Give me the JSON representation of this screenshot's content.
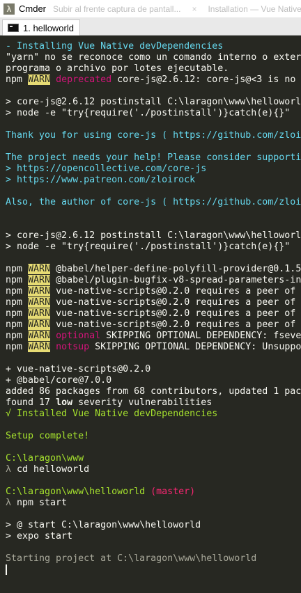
{
  "window": {
    "title": "Cmder",
    "ghost_tab_1": "Subir al frente captura de pantall...",
    "ghost_tab_1_close": "×",
    "ghost_tab_2": "Installation — Vue Native"
  },
  "tab": {
    "label": "1. helloworld"
  },
  "colors": {
    "background": "#272822",
    "warn_bg": "#e6db74",
    "accent_cyan": "#66d9ef",
    "accent_green": "#a6e22e"
  },
  "console": {
    "installing": "- Installing Vue Native devDependencies",
    "yarn_error_1": "\"yarn\" no se reconoce como un comando interno o exter",
    "yarn_error_2": "programa o archivo por lotes ejecutable.",
    "npm": "npm",
    "warn": "WARN",
    "deprecated": "deprecated",
    "deprecated_msg": " core-js@2.6.12: core-js@<3 is no",
    "postinstall_1a": "> core-js@2.6.12 postinstall C:\\laragon\\www\\helloworl",
    "postinstall_1b": "> node -e \"try{require('./postinstall')}catch(e){}\"",
    "thanks_prefix": "Thank you for using core-js ( ",
    "thanks_link": "https://github.com/zloi",
    "needs_help": "The project needs your help! Please consider supporti",
    "opencollective": "> https://opencollective.com/core-js",
    "patreon": "> https://www.patreon.com/zloirock",
    "author_prefix": "Also, the author of core-js ( ",
    "author_link": "https://github.com/zloi",
    "postinstall_2a": "> core-js@2.6.12 postinstall C:\\laragon\\www\\helloworl",
    "postinstall_2b": "> node -e \"try{require('./postinstall')}catch(e){}\"",
    "warn_1": " @babel/helper-define-polyfill-provider@0.1.5",
    "warn_2": " @babel/plugin-bugfix-v8-spread-parameters-in",
    "warn_3": " vue-native-scripts@0.2.0 requires a peer of",
    "warn_4": " vue-native-scripts@0.2.0 requires a peer of",
    "warn_5": " vue-native-scripts@0.2.0 requires a peer of",
    "warn_6": " vue-native-scripts@0.2.0 requires a peer of",
    "optional": "optional",
    "optional_msg": " SKIPPING OPTIONAL DEPENDENCY: fseve",
    "notsup": "notsup",
    "notsup_msg": " SKIPPING OPTIONAL DEPENDENCY: Unsuppo",
    "added_1": "+ vue-native-scripts@0.2.0",
    "added_2": "+ @babel/core@7.0.0",
    "added_3": "added 86 packages from 68 contributors, updated 1 pac",
    "found_prefix": "found 17 ",
    "found_low": "low",
    "found_suffix": " severity vulnerabilities",
    "installed": "√ Installed Vue Native devDependencies",
    "setup_complete": "Setup complete!",
    "path_1": "C:\\laragon\\www",
    "prompt_symbol": "λ",
    "cmd_1": " cd helloworld",
    "path_2": "C:\\laragon\\www\\helloworld",
    "branch": " (master)",
    "cmd_2": " npm start",
    "start_1": "> @ start C:\\laragon\\www\\helloworld",
    "start_2": "> expo start",
    "starting": "Starting project at C:\\laragon\\www\\helloworld"
  }
}
